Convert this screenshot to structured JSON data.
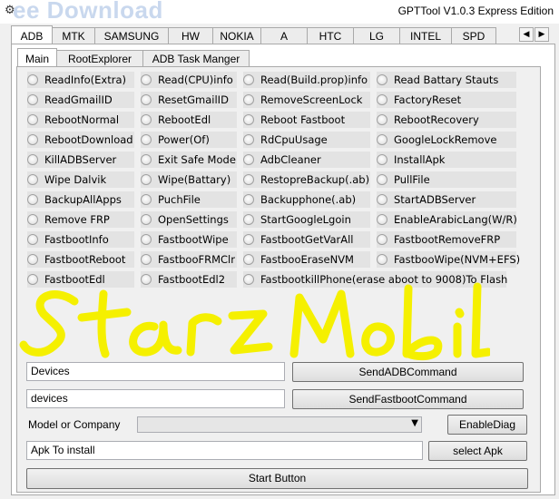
{
  "window": {
    "title": "GPTTool V1.0.3 Express Edition",
    "watermark": "ee Download",
    "icon": "gear-icon"
  },
  "main_tabs": [
    "ADB",
    "MTK",
    "SAMSUNG",
    "HW",
    "NOKIA",
    "A",
    "HTC",
    "LG",
    "INTEL",
    "SPD"
  ],
  "main_tab_active": "ADB",
  "scroll_left_glyph": "◀",
  "scroll_right_glyph": "▶",
  "sub_tabs": [
    "Main",
    "RootExplorer",
    "ADB Task Manger"
  ],
  "sub_tab_active": "Main",
  "options": {
    "col1": [
      "ReadInfo(Extra)",
      "ReadGmailID",
      "RebootNormal",
      "RebootDownload",
      "KillADBServer",
      "Wipe Dalvik",
      "BackupAllApps",
      "Remove FRP",
      "FastbootInfo",
      "FastbootReboot",
      "FastbootEdl"
    ],
    "col2": [
      "Read(CPU)info",
      "ResetGmailID",
      "RebootEdl",
      "Power(Of)",
      "Exit Safe Mode",
      "Wipe(Battary)",
      "PuchFile",
      "OpenSettings",
      "FastbootWipe",
      "FastbooFRMClr",
      "FastbootEdl2"
    ],
    "col3": [
      "Read(Build.prop)info",
      "RemoveScreenLock",
      "Reboot Fastboot",
      "RdCpuUsage",
      "AdbCleaner",
      "RestopreBackup(.ab)",
      "Backupphone(.ab)",
      "StartGoogleLgoin",
      "FastbootGetVarAll",
      "FastbooEraseNVM",
      "FastbootkillPhone(erase aboot to 9008)To Flash"
    ],
    "col4": [
      "Read Battary Stauts",
      "FactoryReset",
      "RebootRecovery",
      "GoogleLockRemove",
      "InstallApk",
      "PullFile",
      "StartADBServer",
      "EnableArabicLang(W/R)",
      "FastbootRemoveFRP",
      "FastbooWipe(NVM+EFS)"
    ]
  },
  "overlay_text": "Star Mobil",
  "overlay_color": "#f5f000",
  "adb_command": {
    "value": "Devices",
    "button": "SendADBCommand"
  },
  "fastboot_command": {
    "value": "devices",
    "button": "SendFastbootCommand"
  },
  "model_label": "Model or Company",
  "model_select_value": "",
  "enable_diag_button": "EnableDiag",
  "apk_field": {
    "value": "Apk To install",
    "button": "select Apk"
  },
  "start_button": "Start Button"
}
